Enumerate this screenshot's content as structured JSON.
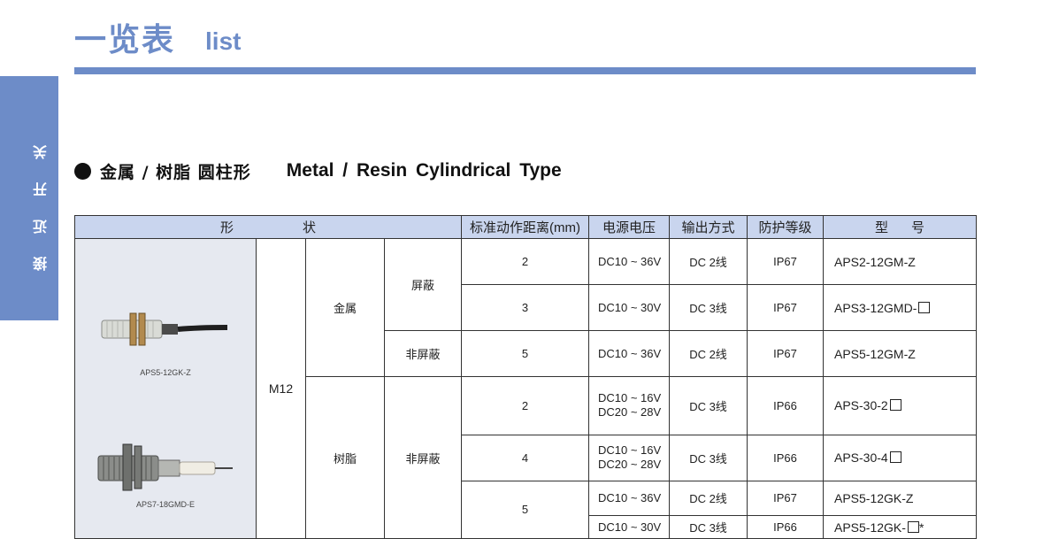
{
  "header": {
    "title_cn": "一览表",
    "title_en": "list"
  },
  "side_tab": {
    "label": "接近开关"
  },
  "section": {
    "title_cn": "金属 / 树脂  圆柱形",
    "title_en": "Metal / Resin  Cylindrical  Type"
  },
  "table": {
    "headers": {
      "shape_1": "形",
      "shape_2": "状",
      "distance": "标准动作距离(mm)",
      "voltage": "电源电压",
      "output": "输出方式",
      "protection": "防护等级",
      "model_1": "型",
      "model_2": "号"
    },
    "image_captions": [
      "APS5-12GK-Z",
      "APS7-18GMD-E"
    ],
    "size": "M12",
    "material_metal": "金属",
    "material_resin": "树脂",
    "shield": "屏蔽",
    "unshield": "非屏蔽",
    "rows": [
      {
        "distance": "2",
        "voltage": "DC10 ~ 36V",
        "output": "DC 2线",
        "ip": "IP67",
        "model": "APS2-12GM-Z"
      },
      {
        "distance": "3",
        "voltage": "DC10 ~ 30V",
        "output": "DC 3线",
        "ip": "IP67",
        "model": "APS3-12GMD-"
      },
      {
        "distance": "5",
        "voltage": "DC10 ~ 36V",
        "output": "DC 2线",
        "ip": "IP67",
        "model": "APS5-12GM-Z"
      },
      {
        "distance": "2",
        "voltage": "DC10 ~ 16V",
        "voltage2": "DC20 ~ 28V",
        "output": "DC 3线",
        "ip": "IP66",
        "model": "APS-30-2"
      },
      {
        "distance": "4",
        "voltage": "DC10 ~ 16V",
        "voltage2": "DC20 ~ 28V",
        "output": "DC 3线",
        "ip": "IP66",
        "model": "APS-30-4"
      },
      {
        "distance": "5",
        "voltage": "DC10 ~ 36V",
        "output": "DC 2线",
        "ip": "IP67",
        "model": "APS5-12GK-Z"
      },
      {
        "voltage": "DC10 ~ 30V",
        "output": "DC 3线",
        "ip": "IP66",
        "model": "APS5-12GK-",
        "model_suffix": "*"
      }
    ]
  },
  "colors": {
    "accent": "#6d8cc8",
    "header_bg": "#c9d5ee",
    "image_bg": "#e6e9f0"
  }
}
